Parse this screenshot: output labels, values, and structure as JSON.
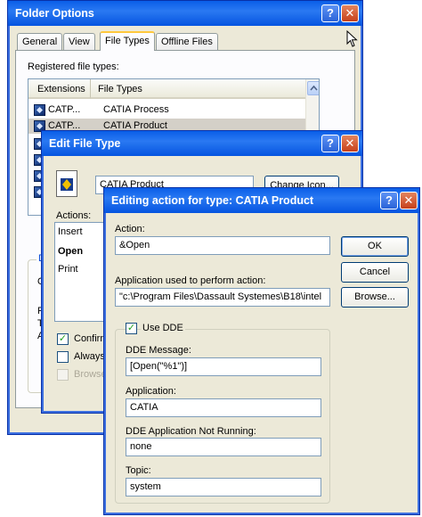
{
  "folder_options": {
    "title": "Folder Options",
    "tabs": [
      {
        "label": "General"
      },
      {
        "label": "View"
      },
      {
        "label": "File Types"
      },
      {
        "label": "Offline Files"
      }
    ],
    "registered_label": "Registered file types:",
    "columns": {
      "extensions": "Extensions",
      "file_types": "File Types"
    },
    "rows": [
      {
        "ext": "CATP...",
        "type": "CATIA Process"
      },
      {
        "ext": "CATP...",
        "type": "CATIA Product"
      }
    ],
    "group_letter": "D",
    "partial_letters": [
      "O",
      "F",
      "T",
      "A"
    ]
  },
  "edit_file_type": {
    "title": "Edit File Type",
    "name_value": "CATIA Product",
    "change_icon_label": "Change Icon...",
    "actions_label": "Actions:",
    "actions": [
      {
        "label": "Insert"
      },
      {
        "label": "Open"
      },
      {
        "label": "Print"
      }
    ],
    "confirm_label": "Confirm",
    "always_label": "Always",
    "browse_label": "Browse"
  },
  "editing_action": {
    "title": "Editing action for type: CATIA Product",
    "action_label": "Action:",
    "action_value": "&Open",
    "ok_label": "OK",
    "cancel_label": "Cancel",
    "browse_label": "Browse...",
    "app_label": "Application used to perform action:",
    "app_value": "\"c:\\Program Files\\Dassault Systemes\\B18\\intel",
    "use_dde_label": "Use DDE",
    "dde_message_label": "DDE Message:",
    "dde_message_value": "[Open(\"%1\")]",
    "application_label": "Application:",
    "application_value": "CATIA",
    "not_running_label": "DDE Application Not Running:",
    "not_running_value": "none",
    "topic_label": "Topic:",
    "topic_value": "system"
  },
  "titlebar_buttons": {
    "help": "?",
    "close": "✕"
  },
  "colors": {
    "title_bar": "#0a5ee8",
    "dialog_bg": "#ece9d8",
    "selection": "#d4d0c8"
  }
}
